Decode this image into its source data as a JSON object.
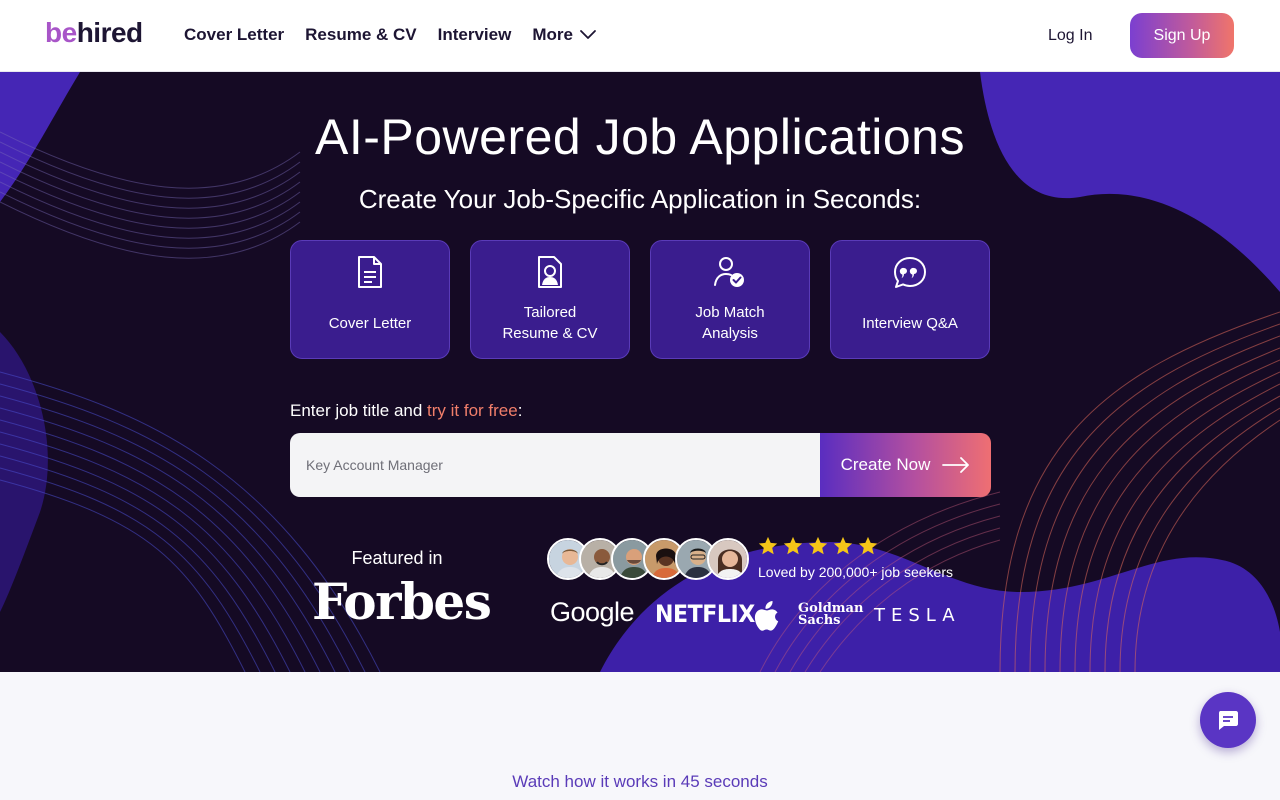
{
  "header": {
    "logo_be": "be",
    "logo_hired": "hired",
    "nav": [
      "Cover Letter",
      "Resume & CV",
      "Interview",
      "More"
    ],
    "login": "Log In",
    "signup": "Sign Up"
  },
  "hero": {
    "title": "AI-Powered Job Applications",
    "subtitle": "Create Your Job-Specific Application in Seconds:",
    "cards": [
      {
        "line1": "Cover Letter",
        "line2": "",
        "icon": "document-icon"
      },
      {
        "line1": "Tailored",
        "line2": "Resume & CV",
        "icon": "resume-icon"
      },
      {
        "line1": "Job Match",
        "line2": "Analysis",
        "icon": "user-check-icon"
      },
      {
        "line1": "Interview Q&A",
        "line2": "",
        "icon": "quote-bubble-icon"
      }
    ],
    "prompt_prefix": "Enter job title and ",
    "prompt_accent": "try it for free",
    "prompt_suffix": ":",
    "search_placeholder": "Key Account Manager",
    "create_label": "Create Now",
    "featured_in": "Featured in",
    "forbes": "Forbes",
    "rating_stars": 5,
    "loved": "Loved by 200,000+ job seekers",
    "brands": {
      "google": "Google",
      "netflix": "NETFLIX",
      "goldman_line1": "Goldman",
      "goldman_line2": "Sachs",
      "tesla": "TESLA"
    }
  },
  "below": {
    "watch": "Watch how it works in 45 seconds"
  },
  "colors": {
    "accent": "#5a35c4",
    "accent_orange": "#f07e6a",
    "hero_bg": "#150a24",
    "card_bg": "#3a1d8e"
  }
}
